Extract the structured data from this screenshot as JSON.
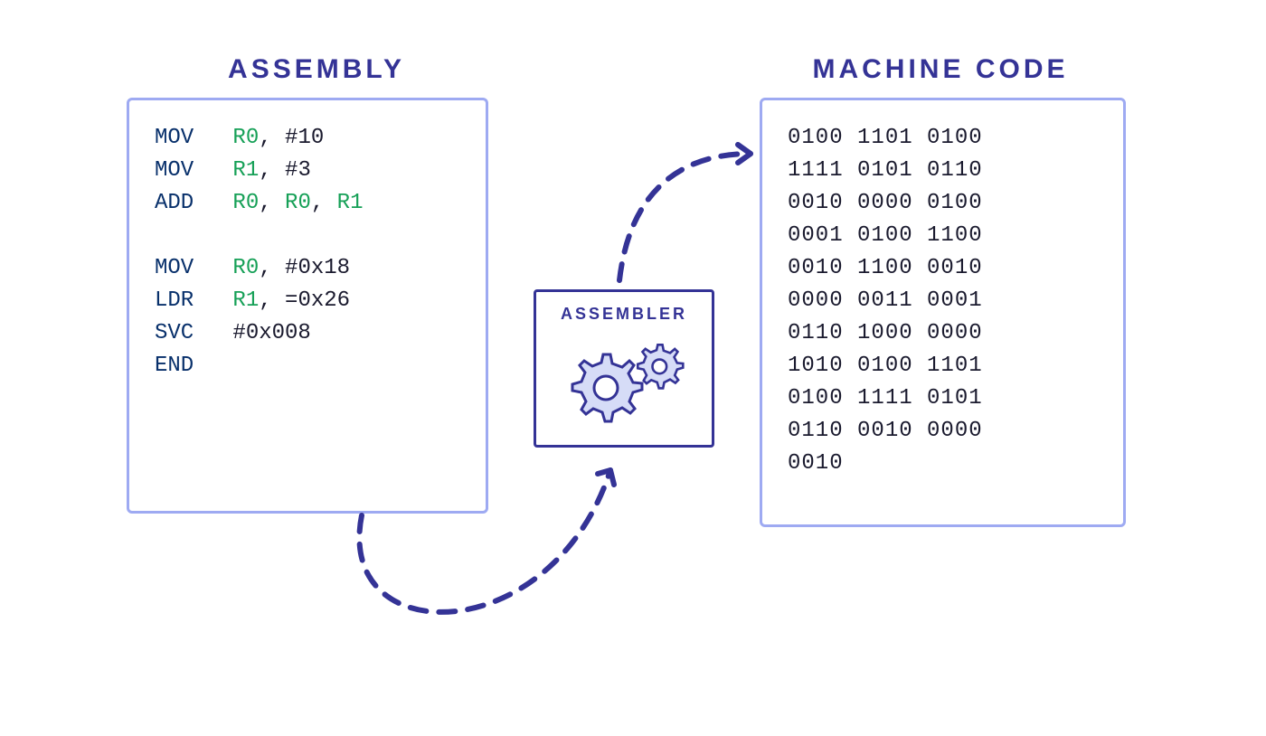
{
  "titles": {
    "left": "ASSEMBLY",
    "right": "MACHINE CODE",
    "mid": "ASSEMBLER"
  },
  "assembly": [
    {
      "op": "MOV",
      "args": [
        {
          "t": "reg",
          "v": "R0"
        },
        {
          "t": "imm",
          "v": "#10"
        }
      ]
    },
    {
      "op": "MOV",
      "args": [
        {
          "t": "reg",
          "v": "R1"
        },
        {
          "t": "imm",
          "v": "#3"
        }
      ]
    },
    {
      "op": "ADD",
      "args": [
        {
          "t": "reg",
          "v": "R0"
        },
        {
          "t": "reg",
          "v": "R0"
        },
        {
          "t": "reg",
          "v": "R1"
        }
      ]
    },
    {
      "blank": true
    },
    {
      "op": "MOV",
      "args": [
        {
          "t": "reg",
          "v": "R0"
        },
        {
          "t": "imm",
          "v": "#0x18"
        }
      ]
    },
    {
      "op": "LDR",
      "args": [
        {
          "t": "reg",
          "v": "R1"
        },
        {
          "t": "imm",
          "v": "=0x26"
        }
      ]
    },
    {
      "op": "SVC",
      "args": [
        {
          "t": "imm",
          "v": "#0x008"
        }
      ]
    },
    {
      "op": "END",
      "args": []
    }
  ],
  "machine": [
    "0100 1101 0100",
    "1111 0101 0110",
    "0010 0000 0100",
    "0001 0100 1100",
    "0010 1100 0010",
    "0000 0011 0001",
    "0110 1000 0000",
    "1010 0100 1101",
    "0100 1111 0101",
    "0110 0010 0000",
    "0010"
  ],
  "colors": {
    "border_light": "#9eaaf2",
    "border_dark": "#343396",
    "gear_fill": "#d6dcf7"
  }
}
